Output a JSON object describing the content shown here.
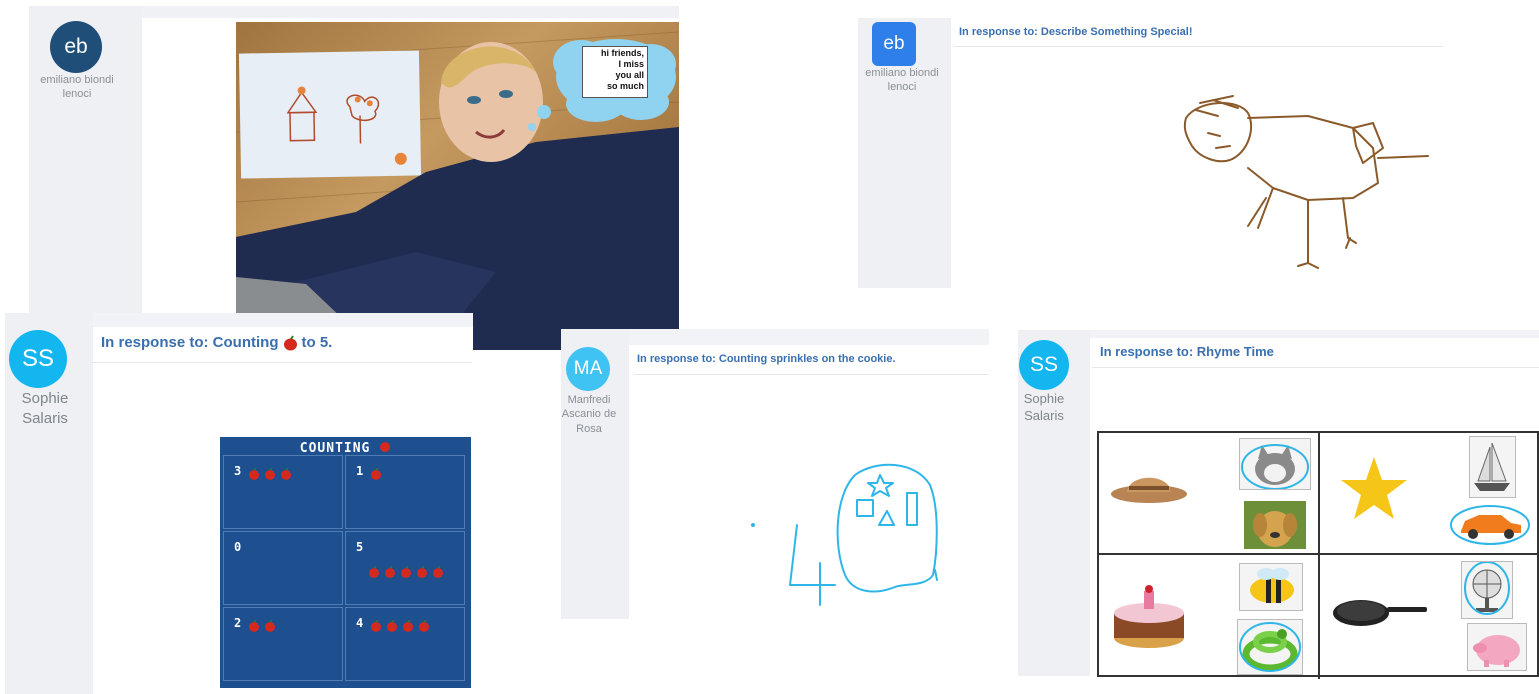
{
  "posts": [
    {
      "author": "emiliano biondi lenoci",
      "author_line1": "emiliano biondi",
      "author_line2": "lenoci",
      "initials": "eb",
      "avatar_color": "#1f4e79",
      "photo": {
        "thought_bubble": [
          "hi friends,",
          "I miss",
          "you all",
          "so much"
        ]
      }
    },
    {
      "author": "emiliano biondi lenoci",
      "author_line1": "emiliano biondi",
      "author_line2": "lenoci",
      "initials": "eb",
      "avatar_color": "#1a73e8",
      "prompt": "In response to: Describe Something Special!"
    },
    {
      "author": "Sophie Salaris",
      "author_line1": "Sophie",
      "author_line2": "Salaris",
      "initials": "SS",
      "avatar_color": "#14b6f0",
      "prompt_prefix": "In response to: Counting",
      "prompt_suffix": "to 5.",
      "worksheet": {
        "title": "COUNTING",
        "cells": [
          {
            "number": "3",
            "count": 3
          },
          {
            "number": "1",
            "count": 1
          },
          {
            "number": "0",
            "count": 0
          },
          {
            "number": "5",
            "count": 5
          },
          {
            "number": "2",
            "count": 2
          },
          {
            "number": "4",
            "count": 4
          }
        ]
      }
    },
    {
      "author": "Manfredi Ascanio de Rosa",
      "author_line1": "Manfredi",
      "author_line2": "Ascanio de",
      "author_line3": "Rosa",
      "initials": "MA",
      "avatar_color": "#3fc3f2",
      "prompt": "In response to: Counting sprinkles on the cookie."
    },
    {
      "author": "Sophie Salaris",
      "author_line1": "Sophie",
      "author_line2": "Salaris",
      "initials": "SS",
      "avatar_color": "#14b6f0",
      "prompt": "In response to: Rhyme Time",
      "rhyme_pictures": [
        "hat",
        "cat",
        "dog",
        "star",
        "boat",
        "car",
        "cake",
        "bee",
        "snake",
        "pan",
        "fan",
        "pig"
      ]
    }
  ],
  "colors": {
    "link_blue": "#3a6fae",
    "sidebar": "#eef0f4",
    "board_blue": "#1e4f8f",
    "drawing_brown": "#8b5a2b",
    "drawing_cyan": "#2fb6e8"
  }
}
